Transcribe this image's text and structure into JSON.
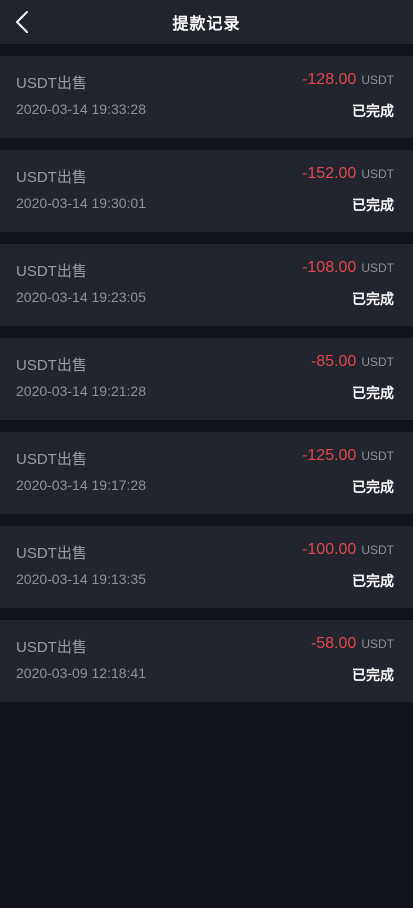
{
  "header": {
    "title": "提款记录"
  },
  "records": [
    {
      "name": "USDT出售",
      "time": "2020-03-14 19:33:28",
      "amount": "-128.00",
      "unit": "USDT",
      "status": "已完成"
    },
    {
      "name": "USDT出售",
      "time": "2020-03-14 19:30:01",
      "amount": "-152.00",
      "unit": "USDT",
      "status": "已完成"
    },
    {
      "name": "USDT出售",
      "time": "2020-03-14 19:23:05",
      "amount": "-108.00",
      "unit": "USDT",
      "status": "已完成"
    },
    {
      "name": "USDT出售",
      "time": "2020-03-14 19:21:28",
      "amount": "-85.00",
      "unit": "USDT",
      "status": "已完成"
    },
    {
      "name": "USDT出售",
      "time": "2020-03-14 19:17:28",
      "amount": "-125.00",
      "unit": "USDT",
      "status": "已完成"
    },
    {
      "name": "USDT出售",
      "time": "2020-03-14 19:13:35",
      "amount": "-100.00",
      "unit": "USDT",
      "status": "已完成"
    },
    {
      "name": "USDT出售",
      "time": "2020-03-09 12:18:41",
      "amount": "-58.00",
      "unit": "USDT",
      "status": "已完成"
    }
  ],
  "colors": {
    "background": "#12141c",
    "card": "#22242e",
    "amount_negative": "#e04a4f",
    "status_text": "#ffffff"
  },
  "icons": {
    "back": "chevron-left-icon"
  }
}
